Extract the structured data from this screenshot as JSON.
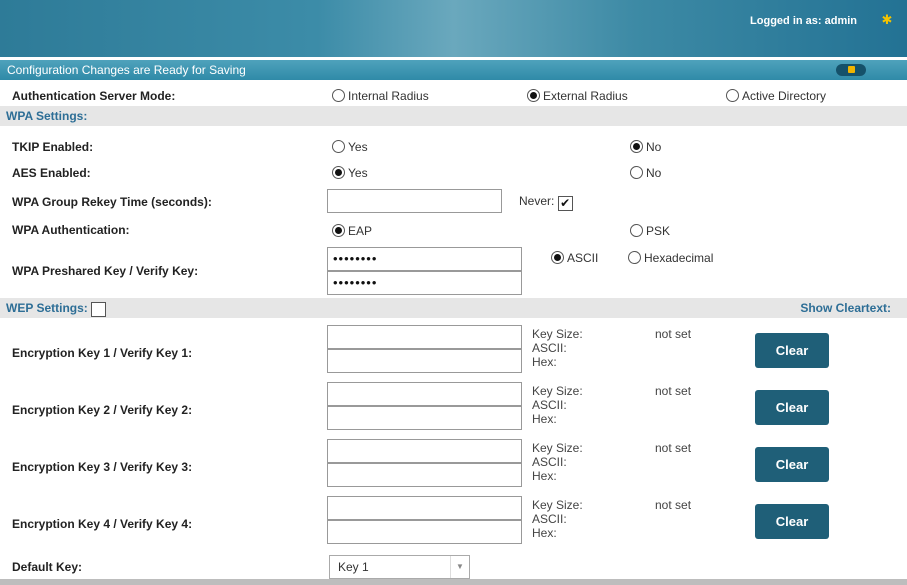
{
  "header": {
    "logged_in_text": "Logged in as: admin",
    "gear_icon": "gear-icon"
  },
  "status_bar": {
    "message": "Configuration Changes are Ready for Saving",
    "save_icon": "save-icon"
  },
  "auth_server": {
    "label": "Authentication Server Mode:",
    "options": [
      "Internal Radius",
      "External Radius",
      "Active Directory"
    ],
    "selected": "External Radius"
  },
  "wpa": {
    "section_title": "WPA Settings:",
    "tkip": {
      "label": "TKIP Enabled:",
      "yes": "Yes",
      "no": "No",
      "selected": "No"
    },
    "aes": {
      "label": "AES Enabled:",
      "yes": "Yes",
      "no": "No",
      "selected": "Yes"
    },
    "rekey": {
      "label": "WPA Group Rekey Time (seconds):",
      "value": "",
      "never_label": "Never:",
      "never_checked": true
    },
    "auth": {
      "label": "WPA Authentication:",
      "eap": "EAP",
      "psk": "PSK",
      "selected": "EAP"
    },
    "psk": {
      "label": "WPA Preshared Key / Verify Key:",
      "key_value": "••••••••",
      "verify_value": "••••••••",
      "ascii": "ASCII",
      "hex": "Hexadecimal",
      "selected": "ASCII"
    }
  },
  "wep": {
    "section_title": "WEP Settings:",
    "show_cleartext_label": "Show Cleartext:",
    "show_cleartext_checked": false,
    "keys": [
      {
        "label": "Encryption Key 1 / Verify Key 1:",
        "key_size_label": "Key Size:",
        "key_size_value": "not set",
        "ascii_label": "ASCII:",
        "hex_label": "Hex:",
        "clear_label": "Clear"
      },
      {
        "label": "Encryption Key 2 / Verify Key 2:",
        "key_size_label": "Key Size:",
        "key_size_value": "not set",
        "ascii_label": "ASCII:",
        "hex_label": "Hex:",
        "clear_label": "Clear"
      },
      {
        "label": "Encryption Key 3 / Verify Key 3:",
        "key_size_label": "Key Size:",
        "key_size_value": "not set",
        "ascii_label": "ASCII:",
        "hex_label": "Hex:",
        "clear_label": "Clear"
      },
      {
        "label": "Encryption Key 4 / Verify Key 4:",
        "key_size_label": "Key Size:",
        "key_size_value": "not set",
        "ascii_label": "ASCII:",
        "hex_label": "Hex:",
        "clear_label": "Clear"
      }
    ],
    "default_key": {
      "label": "Default Key:",
      "value": "Key 1"
    }
  }
}
